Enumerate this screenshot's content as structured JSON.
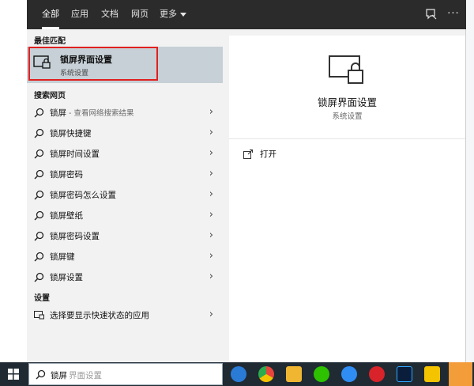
{
  "tabs": [
    {
      "label": "全部",
      "active": true
    },
    {
      "label": "应用"
    },
    {
      "label": "文档"
    },
    {
      "label": "网页"
    },
    {
      "label": "更多"
    }
  ],
  "top_icons": [
    "feedback-icon",
    "more-icon"
  ],
  "more_dots": "···",
  "best_match": {
    "section": "最佳匹配",
    "title": "锁屏界面设置",
    "subtitle": "系统设置"
  },
  "web_search": {
    "section": "搜索网页",
    "items": [
      {
        "text": "锁屏",
        "hint": " - 查看网络搜索结果"
      },
      {
        "text": "锁屏快捷键"
      },
      {
        "text": "锁屏时间设置"
      },
      {
        "text": "锁屏密码"
      },
      {
        "text": "锁屏密码怎么设置"
      },
      {
        "text": "锁屏壁纸"
      },
      {
        "text": "锁屏密码设置"
      },
      {
        "text": "锁屏键"
      },
      {
        "text": "锁屏设置"
      }
    ]
  },
  "settings": {
    "section": "设置",
    "items": [
      {
        "text": "选择要显示快速状态的应用"
      }
    ]
  },
  "preview": {
    "title": "锁屏界面设置",
    "subtitle": "系统设置",
    "open_label": "打开"
  },
  "taskbar": {
    "search_typed": "锁屏",
    "search_ghost": "界面设置",
    "apps": [
      {
        "name": "sogou-icon",
        "color": "#2a7bd6"
      },
      {
        "name": "chrome-icon",
        "color": "#e8453c"
      },
      {
        "name": "file-explorer-icon",
        "color": "#f0b632"
      },
      {
        "name": "wechat-icon",
        "color": "#2dc100"
      },
      {
        "name": "feishu-icon",
        "color": "#2f8cf2"
      },
      {
        "name": "netease-music-icon",
        "color": "#d8232a"
      },
      {
        "name": "photoshop-icon",
        "color": "#0a1e3c"
      },
      {
        "name": "notes-icon",
        "color": "#f5c400"
      },
      {
        "name": "chrome-active-icon",
        "color": "#f39c3a"
      }
    ]
  },
  "colors": {
    "topbar": "#2b2b2b",
    "highlight": "#c6d0d6",
    "annotation_border": "#e02020",
    "taskbar": "#1f2a33"
  }
}
